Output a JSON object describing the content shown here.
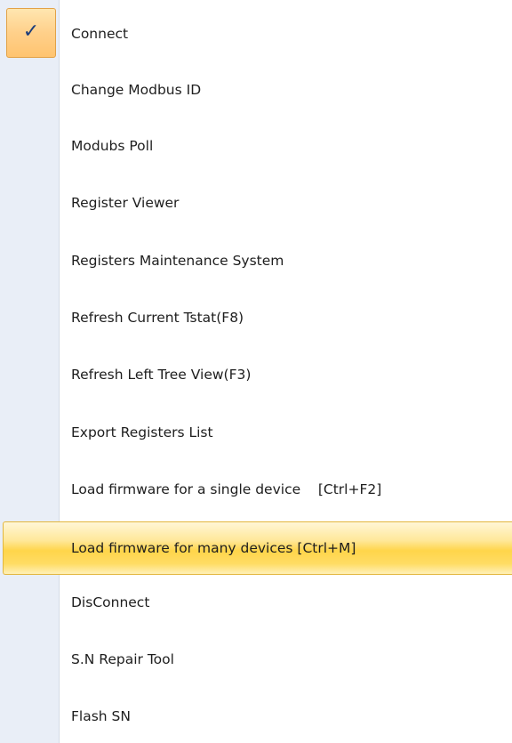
{
  "menu": {
    "items": [
      {
        "label": "Connect",
        "checked": true,
        "highlighted": false
      },
      {
        "label": "Change Modbus ID",
        "checked": false,
        "highlighted": false
      },
      {
        "label": "Modubs Poll",
        "checked": false,
        "highlighted": false
      },
      {
        "label": "Register Viewer",
        "checked": false,
        "highlighted": false
      },
      {
        "label": "Registers Maintenance System",
        "checked": false,
        "highlighted": false
      },
      {
        "label": "Refresh Current Tstat(F8)",
        "checked": false,
        "highlighted": false
      },
      {
        "label": "Refresh Left Tree View(F3)",
        "checked": false,
        "highlighted": false
      },
      {
        "label": "Export Registers List",
        "checked": false,
        "highlighted": false
      },
      {
        "label": "Load firmware for a single device    [Ctrl+F2]",
        "checked": false,
        "highlighted": false
      },
      {
        "label": "Load firmware for many devices [Ctrl+M]",
        "checked": false,
        "highlighted": true
      },
      {
        "label": "DisConnect",
        "checked": false,
        "highlighted": false
      },
      {
        "label": "S.N Repair Tool",
        "checked": false,
        "highlighted": false
      },
      {
        "label": "Flash SN",
        "checked": false,
        "highlighted": false
      }
    ],
    "check_glyph": "✓"
  },
  "colors": {
    "gutter": "#e9eef7",
    "highlight": "#ffd54a",
    "check_background": "#ffd08a",
    "text": "#1e1e1e"
  },
  "icons": {
    "check": "check-icon"
  }
}
